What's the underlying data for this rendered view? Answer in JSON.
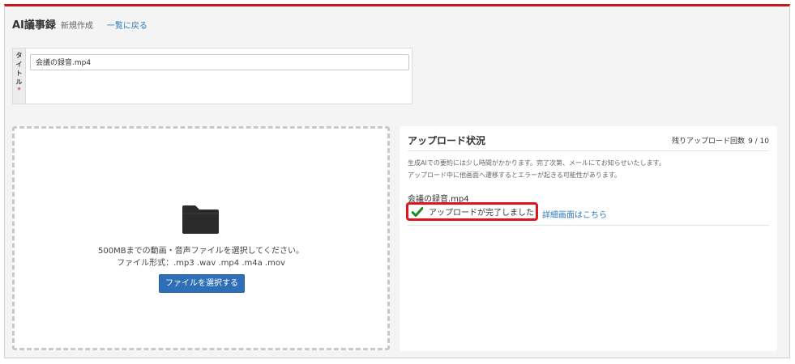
{
  "header": {
    "app_title": "AI議事録",
    "subtitle": "新規作成",
    "back_link": "一覧に戻る"
  },
  "title_field": {
    "label_chars": [
      "タ",
      "イ",
      "ト",
      "ル"
    ],
    "required_mark": "*",
    "value": "会議の録音.mp4"
  },
  "dropzone": {
    "icon": "folder-icon",
    "instruction": "500MBまでの動画・音声ファイルを選択してください。",
    "formats": "ファイル形式：.mp3 .wav .mp4 .m4a .mov",
    "button_label": "ファイルを選択する"
  },
  "status": {
    "title": "アップロード状況",
    "remaining_label": "残りアップロード回数",
    "remaining_count": "9 / 10",
    "note1": "生成AIでの要約には少し時間がかかります。完了次第、メールにてお知らせいたします。",
    "note2": "アップロード中に他画面へ遷移するとエラーが起きる可能性があります。",
    "file_name": "会議の録音.mp4",
    "complete_icon": "check-icon",
    "complete_text": "アップロードが完了しました",
    "detail_link": "詳細画面はこちら"
  },
  "colors": {
    "accent_red": "#c8161d",
    "highlight_red": "#e0141c",
    "button_blue": "#2e6fb7",
    "link_blue": "#2a7ab5",
    "check_green": "#1f8a24"
  }
}
